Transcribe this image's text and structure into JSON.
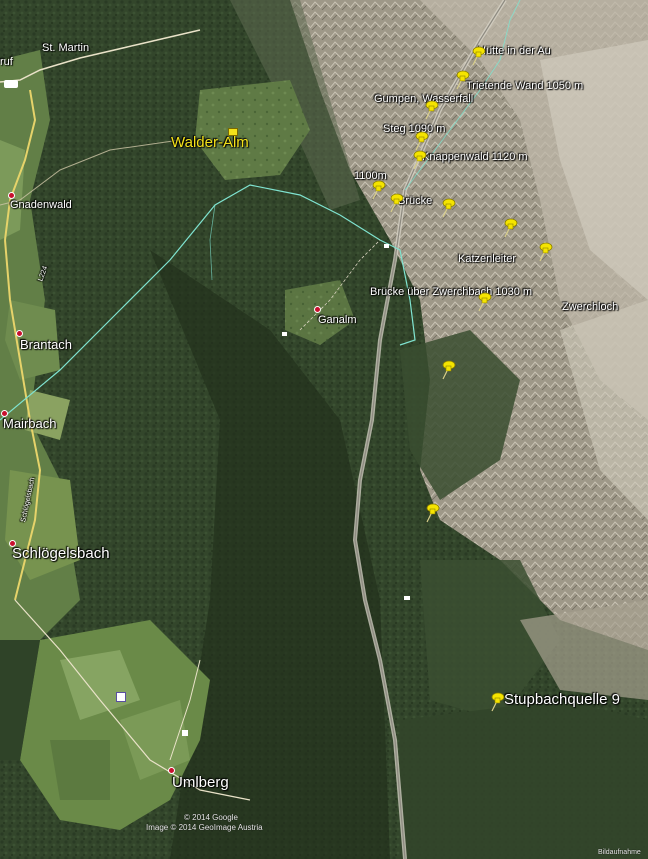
{
  "places": {
    "st_martin": "St. Martin",
    "walder_alm": "Walder-Alm",
    "gnadenwald": "Gnadenwald",
    "brantach": "Brantach",
    "mairbach": "Mairbach",
    "schloegelsbach": "Schlögelsbach",
    "umlberg": "Umlberg",
    "ganalm": "Ganalm",
    "edge_left": "ruf"
  },
  "waypoints": {
    "hutte_au": "Hütte in der Au",
    "trietende_wand": "Trietende Wand 1050 m",
    "gumpen_wasserfall": "Gumpen, Wasserfall",
    "steg": "Steg 1090 m",
    "knappenwald": "Knappenwald 1120 m",
    "point_1100": "1100m",
    "bruecke": "Brücke",
    "katzenleiter": "Katzenleiter",
    "bruecke_zwerchbach": "Brücke über Zwerchbach 1030 m",
    "zwerchloch": "Zwerchloch",
    "stupbachquelle": "Stupbachquelle 9"
  },
  "road_labels": {
    "l1": "L224",
    "l2": "Schlögelsbach"
  },
  "credits": {
    "google": "© 2014 Google",
    "image": "Image © 2014 GeoImage Austria",
    "corner": "Bildaufnahme"
  },
  "colors": {
    "label": "#ffffff",
    "highlight": "#f3e21a",
    "pin": "#f5e400",
    "route": "#7fe3d0",
    "place_marker": "#c8102e"
  }
}
